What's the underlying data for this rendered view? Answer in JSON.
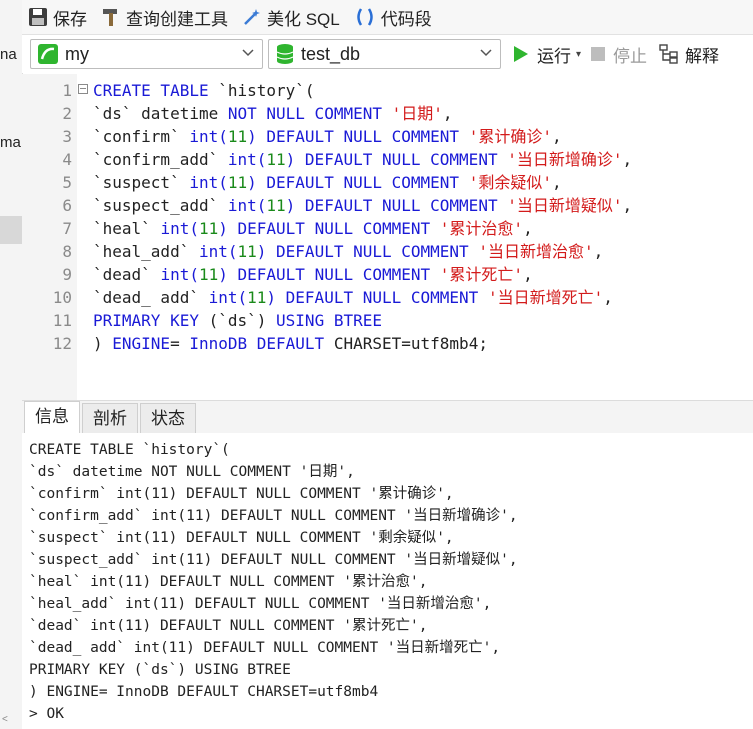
{
  "left_strip": {
    "frag1": "na",
    "frag2": "ma"
  },
  "toolbar": {
    "save": "保存",
    "query_builder": "查询创建工具",
    "beautify": "美化 SQL",
    "snippet": "代码段"
  },
  "selectors": {
    "connection": "my",
    "database": "test_db",
    "run": "运行",
    "stop": "停止",
    "explain": "解释"
  },
  "editor": {
    "lines": [
      {
        "n": "1",
        "tokens": [
          {
            "t": "CREATE TABLE ",
            "c": "kw"
          },
          {
            "t": "`history`(",
            "c": "plain"
          }
        ]
      },
      {
        "n": "2",
        "tokens": [
          {
            "t": "`ds` datetime ",
            "c": "plain"
          },
          {
            "t": "NOT NULL COMMENT ",
            "c": "kw"
          },
          {
            "t": "'日期'",
            "c": "str"
          },
          {
            "t": ",",
            "c": "plain"
          }
        ]
      },
      {
        "n": "3",
        "tokens": [
          {
            "t": "`confirm` ",
            "c": "plain"
          },
          {
            "t": "int(",
            "c": "kw"
          },
          {
            "t": "11",
            "c": "num"
          },
          {
            "t": ") DEFAULT NULL COMMENT ",
            "c": "kw"
          },
          {
            "t": "'累计确诊'",
            "c": "str"
          },
          {
            "t": ",",
            "c": "plain"
          }
        ]
      },
      {
        "n": "4",
        "tokens": [
          {
            "t": "`confirm_add` ",
            "c": "plain"
          },
          {
            "t": "int(",
            "c": "kw"
          },
          {
            "t": "11",
            "c": "num"
          },
          {
            "t": ") DEFAULT NULL COMMENT ",
            "c": "kw"
          },
          {
            "t": "'当日新增确诊'",
            "c": "str"
          },
          {
            "t": ",",
            "c": "plain"
          }
        ]
      },
      {
        "n": "5",
        "tokens": [
          {
            "t": "`suspect` ",
            "c": "plain"
          },
          {
            "t": "int(",
            "c": "kw"
          },
          {
            "t": "11",
            "c": "num"
          },
          {
            "t": ") DEFAULT NULL COMMENT ",
            "c": "kw"
          },
          {
            "t": "'剩余疑似'",
            "c": "str"
          },
          {
            "t": ",",
            "c": "plain"
          }
        ]
      },
      {
        "n": "6",
        "tokens": [
          {
            "t": "`suspect_add` ",
            "c": "plain"
          },
          {
            "t": "int(",
            "c": "kw"
          },
          {
            "t": "11",
            "c": "num"
          },
          {
            "t": ") DEFAULT NULL COMMENT ",
            "c": "kw"
          },
          {
            "t": "'当日新增疑似'",
            "c": "str"
          },
          {
            "t": ",",
            "c": "plain"
          }
        ]
      },
      {
        "n": "7",
        "tokens": [
          {
            "t": "`heal` ",
            "c": "plain"
          },
          {
            "t": "int(",
            "c": "kw"
          },
          {
            "t": "11",
            "c": "num"
          },
          {
            "t": ") DEFAULT NULL COMMENT ",
            "c": "kw"
          },
          {
            "t": "'累计治愈'",
            "c": "str"
          },
          {
            "t": ",",
            "c": "plain"
          }
        ]
      },
      {
        "n": "8",
        "tokens": [
          {
            "t": "`heal_add` ",
            "c": "plain"
          },
          {
            "t": "int(",
            "c": "kw"
          },
          {
            "t": "11",
            "c": "num"
          },
          {
            "t": ") DEFAULT NULL COMMENT ",
            "c": "kw"
          },
          {
            "t": "'当日新增治愈'",
            "c": "str"
          },
          {
            "t": ",",
            "c": "plain"
          }
        ]
      },
      {
        "n": "9",
        "tokens": [
          {
            "t": "`dead` ",
            "c": "plain"
          },
          {
            "t": "int(",
            "c": "kw"
          },
          {
            "t": "11",
            "c": "num"
          },
          {
            "t": ") DEFAULT NULL COMMENT ",
            "c": "kw"
          },
          {
            "t": "'累计死亡'",
            "c": "str"
          },
          {
            "t": ",",
            "c": "plain"
          }
        ]
      },
      {
        "n": "10",
        "tokens": [
          {
            "t": "`dead_ add` ",
            "c": "plain"
          },
          {
            "t": "int(",
            "c": "kw"
          },
          {
            "t": "11",
            "c": "num"
          },
          {
            "t": ") DEFAULT NULL COMMENT ",
            "c": "kw"
          },
          {
            "t": "'当日新增死亡'",
            "c": "str"
          },
          {
            "t": ",",
            "c": "plain"
          }
        ]
      },
      {
        "n": "11",
        "tokens": [
          {
            "t": "PRIMARY KEY ",
            "c": "kw"
          },
          {
            "t": "(`ds`) ",
            "c": "plain"
          },
          {
            "t": "USING BTREE",
            "c": "kw"
          }
        ]
      },
      {
        "n": "12",
        "tokens": [
          {
            "t": ") ",
            "c": "plain"
          },
          {
            "t": "ENGINE",
            "c": "kw"
          },
          {
            "t": "= ",
            "c": "plain"
          },
          {
            "t": "InnoDB DEFAULT ",
            "c": "kw"
          },
          {
            "t": "CHARSET=utf8mb4;",
            "c": "plain"
          }
        ]
      }
    ]
  },
  "tabs": [
    "信息",
    "剖析",
    "状态"
  ],
  "output": {
    "lines": [
      "CREATE TABLE `history`(",
      "`ds` datetime NOT NULL COMMENT '日期',",
      "`confirm` int(11) DEFAULT NULL COMMENT '累计确诊',",
      "`confirm_add` int(11) DEFAULT NULL COMMENT '当日新增确诊',",
      "`suspect` int(11) DEFAULT NULL COMMENT '剩余疑似',",
      "`suspect_add` int(11) DEFAULT NULL COMMENT '当日新增疑似',",
      "`heal` int(11) DEFAULT NULL COMMENT '累计治愈',",
      "`heal_add` int(11) DEFAULT NULL COMMENT '当日新增治愈',",
      "`dead` int(11) DEFAULT NULL COMMENT '累计死亡',",
      "`dead_ add` int(11) DEFAULT NULL COMMENT '当日新增死亡',",
      "PRIMARY KEY (`ds`) USING BTREE",
      ") ENGINE= InnoDB DEFAULT CHARSET=utf8mb4",
      "> OK"
    ]
  },
  "colors": {
    "keyword": "#1a1ad6",
    "number": "#1a8a1a",
    "string": "#d31b1b",
    "run": "#2fb52f"
  }
}
